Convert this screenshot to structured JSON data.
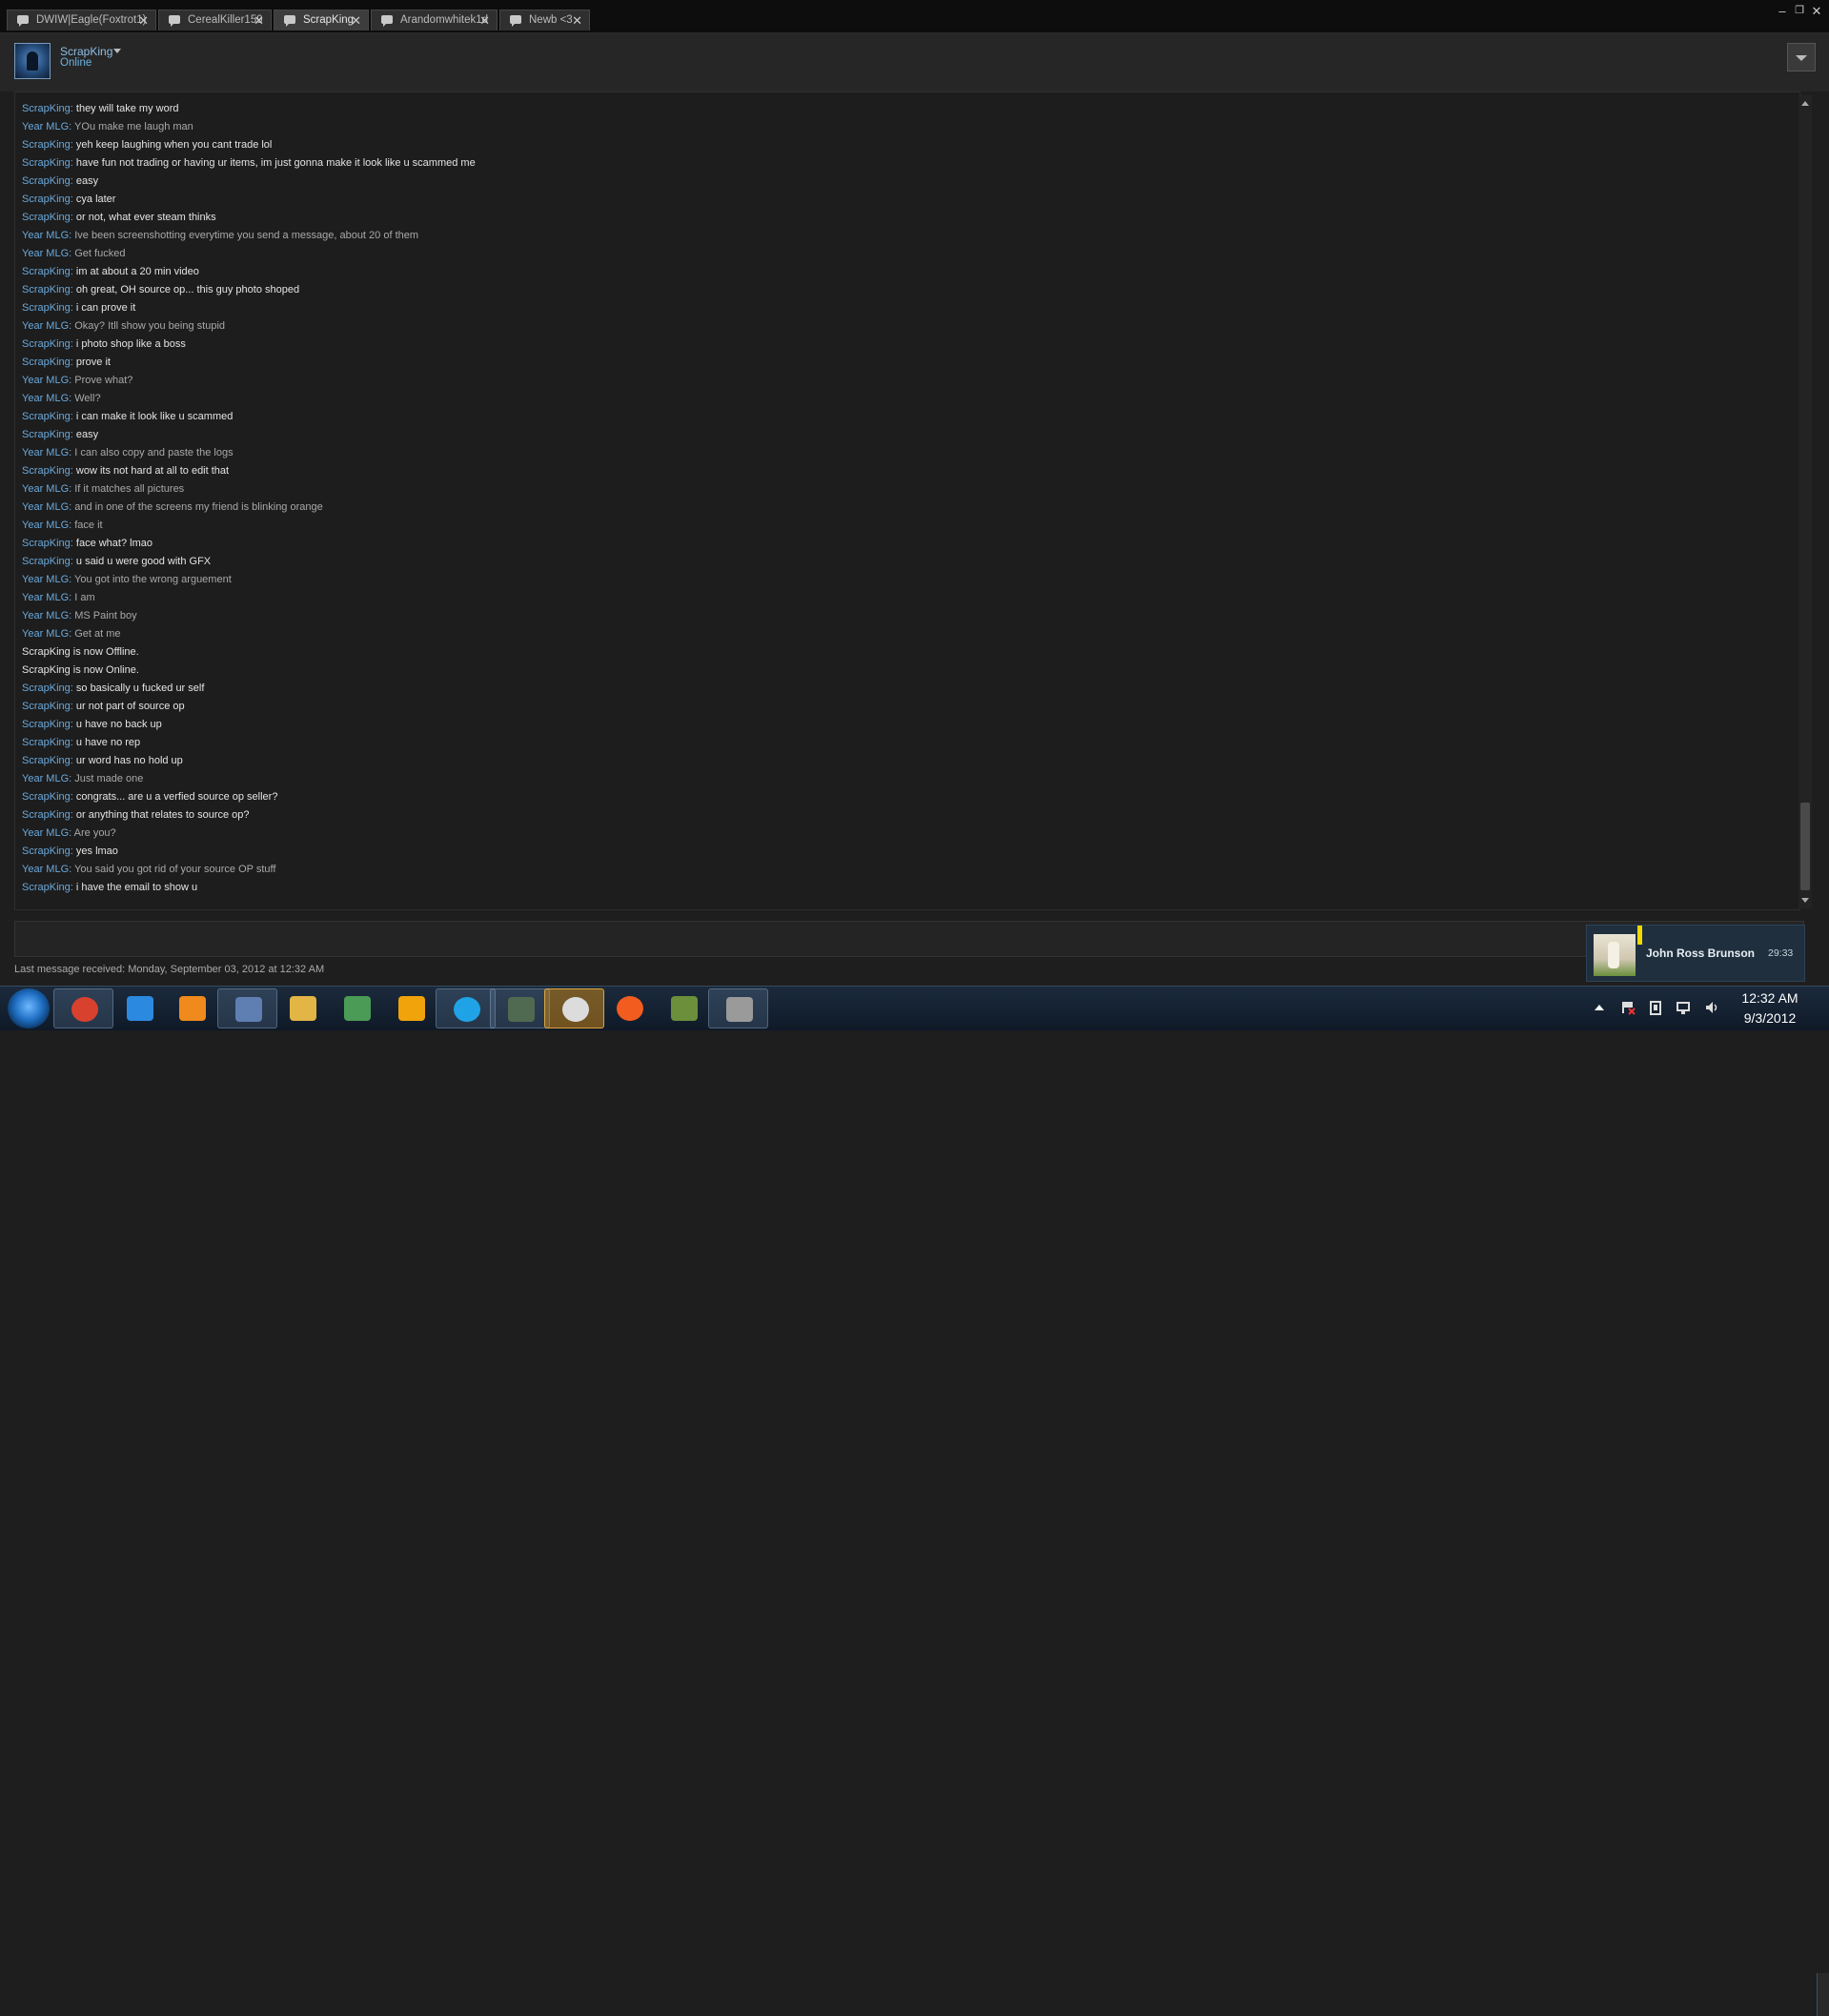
{
  "tabs": [
    {
      "label": "DWIW|Eagle(Foxtrot1)"
    },
    {
      "label": "CerealKiller159"
    },
    {
      "label": "ScrapKing"
    },
    {
      "label": "Arandomwhitek1d"
    },
    {
      "label": "Newb <3"
    }
  ],
  "window_controls": {
    "minimize": "–",
    "restore": "❐",
    "close": "✕"
  },
  "header": {
    "name": "ScrapKing",
    "status": "Online"
  },
  "messages": [
    {
      "sender": "ScrapKing",
      "sep": ": ",
      "text": "they will take my word"
    },
    {
      "sender": "Year MLG",
      "sep": ": ",
      "text": "YOu make me laugh man"
    },
    {
      "sender": "ScrapKing",
      "sep": ": ",
      "text": "yeh keep laughing when you cant trade lol"
    },
    {
      "sender": "ScrapKing",
      "sep": ": ",
      "text": "have fun not trading or having ur items, im just gonna make it look like u scammed me"
    },
    {
      "sender": "ScrapKing",
      "sep": ": ",
      "text": "easy"
    },
    {
      "sender": "ScrapKing",
      "sep": ": ",
      "text": "cya later"
    },
    {
      "sender": "ScrapKing",
      "sep": ": ",
      "text": "or not, what ever steam thinks"
    },
    {
      "sender": "Year MLG",
      "sep": ": ",
      "text": "Ive been screenshotting everytime you send a message, about 20 of them"
    },
    {
      "sender": "Year MLG",
      "sep": ": ",
      "text": "Get fucked"
    },
    {
      "sender": "ScrapKing",
      "sep": ": ",
      "text": "im at about a 20 min video"
    },
    {
      "sender": "ScrapKing",
      "sep": ": ",
      "text": "oh great, OH source op... this guy photo shoped"
    },
    {
      "sender": "ScrapKing",
      "sep": ": ",
      "text": "i can prove it"
    },
    {
      "sender": "Year MLG",
      "sep": ": ",
      "text": "Okay? Itll show you being stupid"
    },
    {
      "sender": "ScrapKing",
      "sep": ": ",
      "text": "i photo shop like a boss"
    },
    {
      "sender": "ScrapKing",
      "sep": ": ",
      "text": "prove it"
    },
    {
      "sender": "Year MLG",
      "sep": ": ",
      "text": "Prove what?"
    },
    {
      "sender": "Year MLG",
      "sep": ": ",
      "text": "Well?"
    },
    {
      "sender": "ScrapKing",
      "sep": ": ",
      "text": "i can make it look like u scammed"
    },
    {
      "sender": "ScrapKing",
      "sep": ": ",
      "text": "easy"
    },
    {
      "sender": "Year MLG",
      "sep": ": ",
      "text": "I can also copy and paste the logs"
    },
    {
      "sender": "ScrapKing",
      "sep": ": ",
      "text": "wow its not hard at all to edit that"
    },
    {
      "sender": "Year MLG",
      "sep": ": ",
      "text": "If it matches all pictures"
    },
    {
      "sender": "Year MLG",
      "sep": ": ",
      "text": "and in one of the screens my friend is blinking orange"
    },
    {
      "sender": "Year MLG",
      "sep": ": ",
      "text": "face it"
    },
    {
      "sender": "ScrapKing",
      "sep": ": ",
      "text": "face what? lmao"
    },
    {
      "sender": "ScrapKing",
      "sep": ": ",
      "text": "u said u were good with GFX"
    },
    {
      "sender": "Year MLG",
      "sep": ": ",
      "text": "You got into the wrong arguement"
    },
    {
      "sender": "Year MLG",
      "sep": ": ",
      "text": "I am"
    },
    {
      "sender": "Year MLG",
      "sep": ": ",
      "text": "MS Paint boy"
    },
    {
      "sender": "Year MLG",
      "sep": ": ",
      "text": "Get at me"
    },
    {
      "sender": "",
      "sep": "",
      "text": "ScrapKing is now Offline."
    },
    {
      "sender": "",
      "sep": "",
      "text": "ScrapKing is now Online."
    },
    {
      "sender": "ScrapKing",
      "sep": ": ",
      "text": "so basically u fucked ur self"
    },
    {
      "sender": "ScrapKing",
      "sep": ": ",
      "text": "ur not part of source op"
    },
    {
      "sender": "ScrapKing",
      "sep": ": ",
      "text": "u have no back up"
    },
    {
      "sender": "ScrapKing",
      "sep": ": ",
      "text": "u have no rep"
    },
    {
      "sender": "ScrapKing",
      "sep": ": ",
      "text": "ur word has no hold up"
    },
    {
      "sender": "Year MLG",
      "sep": ": ",
      "text": "Just made one"
    },
    {
      "sender": "ScrapKing",
      "sep": ": ",
      "text": "congrats... are u a verfied source op seller?"
    },
    {
      "sender": "ScrapKing",
      "sep": ": ",
      "text": "or anything that relates to source op?"
    },
    {
      "sender": "Year MLG",
      "sep": ": ",
      "text": "Are you?"
    },
    {
      "sender": "ScrapKing",
      "sep": ": ",
      "text": "yes lmao"
    },
    {
      "sender": "Year MLG",
      "sep": ": ",
      "text": "You said you got rid of your source OP stuff"
    },
    {
      "sender": "ScrapKing",
      "sep": ": ",
      "text": "i have the email to show u"
    }
  ],
  "footer": {
    "last_message": "Last message received: Monday, September 03, 2012 at 12:32 AM"
  },
  "notification": {
    "name": "John Ross Brunson",
    "time": "29:33"
  },
  "taskbar": {
    "apps": [
      {
        "name": "chrome-icon",
        "color": "#d9412f"
      },
      {
        "name": "internet-explorer-icon",
        "color": "#2b8ae0"
      },
      {
        "name": "media-player-icon",
        "color": "#f08a1c"
      },
      {
        "name": "paint-icon",
        "color": "#5f7fb3"
      },
      {
        "name": "folder-icon",
        "color": "#e2b545"
      },
      {
        "name": "photo-viewer-icon",
        "color": "#4b9b57"
      },
      {
        "name": "atom-app-icon",
        "color": "#f0a30a"
      },
      {
        "name": "skype-icon",
        "color": "#1fa3e6"
      },
      {
        "name": "monitor-app-icon",
        "color": "#4f6a50"
      },
      {
        "name": "steam-icon",
        "color": "#dcdcdc"
      },
      {
        "name": "origin-icon",
        "color": "#f25c1e"
      },
      {
        "name": "minecraft-icon",
        "color": "#6b8f3a"
      },
      {
        "name": "overlay-app-icon",
        "color": "#9a9a9a"
      }
    ],
    "time": "12:32 AM",
    "date": "9/3/2012"
  }
}
